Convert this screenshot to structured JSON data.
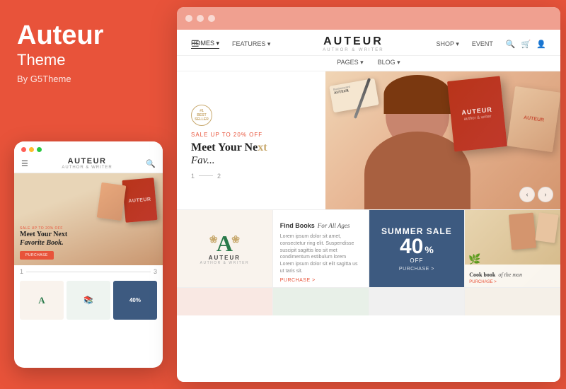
{
  "left": {
    "title": "Auteur",
    "subtitle": "Theme",
    "author": "By G5Theme"
  },
  "mobile": {
    "logo": "AUTEUR",
    "logo_sub": "AUTHOR & WRITER",
    "sale_text": "SALE UP TO 20% OFF",
    "hero_title": "Meet Your Next",
    "hero_italic": "Favorite Book.",
    "purchase_btn": "PURCHASE",
    "page_1": "1",
    "page_3": "3"
  },
  "desktop": {
    "nav_items": [
      "HOMES ▾",
      "FEATURES ▾",
      "SHOP ▾",
      "EVENT"
    ],
    "nav_bottom": [
      "PAGES ▾",
      "BLOG ▾"
    ],
    "logo": "AUTEUR",
    "logo_sub": "AUTHOR & WRITER",
    "hero_award": "#1\nBEST\nSELLER",
    "hero_sale": "SALE UP TO 20% OFF",
    "hero_title": "Meet Your Ne",
    "hero_title2": "xt",
    "hero_italic": "Fav...",
    "page_1": "1",
    "page_2": "2",
    "card_books_title": "Find Books",
    "card_books_italic": "For All Ages",
    "card_books_text": "Lorem ipsum dolor sit amet, consectetur ring elit. Suspendisse suscipit sagittis leo sit met condimentum estibulum lorem Lorem ipsum dolor sit elit sagitta us ut taris sit.",
    "card_books_link": "PURCHASE >",
    "card_sale_title": "SUMMER SALE",
    "card_sale_number": "40",
    "card_sale_pct": "%",
    "card_sale_off": "OFF",
    "card_sale_link": "PURCHASE >",
    "card_auteur_text": "AUTEUR",
    "card_auteur_sub": "AUTHOR & WRITER",
    "cookbook_title": "Cook book",
    "cookbook_italic": "of the mon",
    "cookbook_link": "PURCHASE >"
  },
  "dots": {
    "colors": [
      "#ff5f57",
      "#febc2e",
      "#28c840"
    ]
  }
}
